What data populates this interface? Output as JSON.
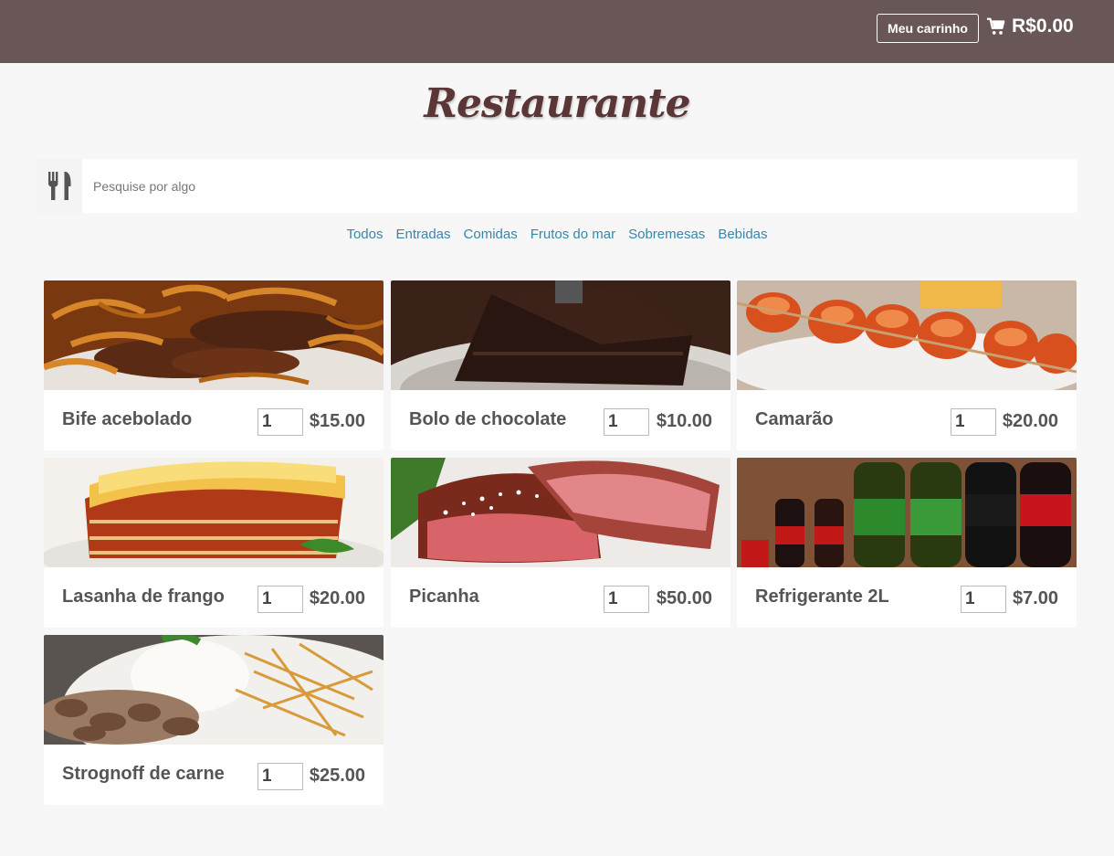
{
  "header": {
    "cart_button_label": "Meu carrinho",
    "cart_total": "R$0.00",
    "cart_icon": "cart-icon"
  },
  "brand": {
    "title": "Restaurante"
  },
  "search": {
    "placeholder": "Pesquise por algo",
    "value": "",
    "icon": "fork-knife-icon"
  },
  "categories": [
    "Todos",
    "Entradas",
    "Comidas",
    "Frutos do mar",
    "Sobremesas",
    "Bebidas"
  ],
  "items": [
    {
      "name": "Bife acebolado",
      "qty": "1",
      "price": "$15.00",
      "photo": "beef-onions-photo"
    },
    {
      "name": "Bolo de chocolate",
      "qty": "1",
      "price": "$10.00",
      "photo": "chocolate-cake-photo"
    },
    {
      "name": "Camarão",
      "qty": "1",
      "price": "$20.00",
      "photo": "shrimp-skewers-photo"
    },
    {
      "name": "Lasanha de frango",
      "qty": "1",
      "price": "$20.00",
      "photo": "lasagna-photo"
    },
    {
      "name": "Picanha",
      "qty": "1",
      "price": "$50.00",
      "photo": "picanha-steak-photo"
    },
    {
      "name": "Refrigerante 2L",
      "qty": "1",
      "price": "$7.00",
      "photo": "soda-bottles-photo"
    },
    {
      "name": "Strognoff de carne",
      "qty": "1",
      "price": "$25.00",
      "photo": "stroganoff-photo"
    }
  ],
  "colors": {
    "header_bg": "#695758",
    "brand_text": "#5a3636",
    "link": "#3a86a8",
    "page_bg": "#f7f7f7"
  }
}
